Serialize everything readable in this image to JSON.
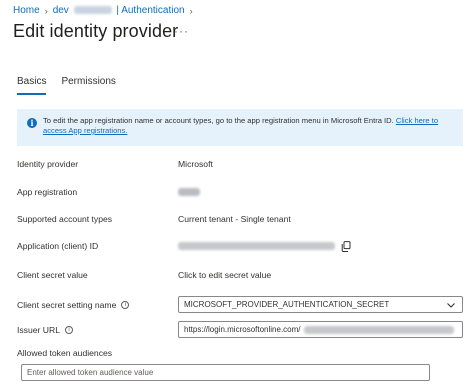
{
  "breadcrumb": {
    "home": "Home",
    "app_prefix": "dev",
    "app_suffix": "| Authentication"
  },
  "page": {
    "title": "Edit identity provider",
    "more": "···"
  },
  "tabs": [
    {
      "label": "Basics",
      "active": true
    },
    {
      "label": "Permissions",
      "active": false
    }
  ],
  "banner": {
    "text": "To edit the app registration name or account types, go to the app registration menu in Microsoft Entra ID.",
    "link": "Click here to access App registrations."
  },
  "fields": {
    "identity_provider": {
      "label": "Identity provider",
      "value": "Microsoft"
    },
    "app_registration": {
      "label": "App registration"
    },
    "account_types": {
      "label": "Supported account types",
      "value": "Current tenant - Single tenant"
    },
    "client_id": {
      "label": "Application (client) ID"
    },
    "client_secret": {
      "label": "Client secret value",
      "value": "Click to edit secret value"
    },
    "secret_setting": {
      "label": "Client secret setting name",
      "value": "MICROSOFT_PROVIDER_AUTHENTICATION_SECRET"
    },
    "issuer_url": {
      "label": "Issuer URL",
      "value": "https://login.microsoftonline.com/"
    },
    "audiences": {
      "label": "Allowed token audiences",
      "placeholder": "Enter allowed token audience value"
    }
  },
  "colors": {
    "accent": "#0f6cbd",
    "banner_bg": "#e5f1fb"
  },
  "icons": [
    "info-icon",
    "help-icon",
    "copy-icon",
    "chevron-down-icon",
    "chevron-right-icon"
  ]
}
